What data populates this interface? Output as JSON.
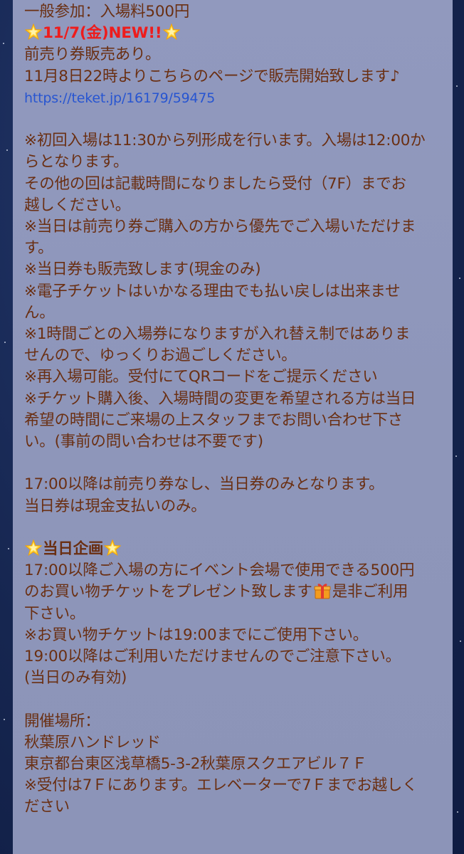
{
  "lines": [
    "一般参加：入場料500円",
    "11/7(金)NEW!!",
    "前売り券販売あり。",
    "11月8日22時よりこちらのページで販売開始致します♪",
    "https://teket.jp/16179/59475",
    "",
    "※初回入場は11:30から列形成を行います。入場は12:00か",
    "らとなります。",
    "その他の回は記載時間になりましたら受付（7F）までお",
    "越しください。",
    "※当日は前売り券ご購入の方から優先でご入場いただけま",
    "す。",
    "※当日券も販売致します(現金のみ)",
    "※電子チケットはいかなる理由でも払い戻しは出来ませ",
    "ん。",
    "※1時間ごとの入場券になりますが入れ替え制ではありま",
    "せんので、ゆっくりお過ごしください。",
    "※再入場可能。受付にてQRコードをご提示ください",
    "※チケット購入後、入場時間の変更を希望される方は当日",
    "希望の時間にご来場の上スタッフまでお問い合わせ下さ",
    "い。(事前の問い合わせは不要です)",
    "",
    "17:00以降は前売り券なし、当日券のみとなります。",
    "当日券は現金支払いのみ。",
    "",
    "当日企画",
    "17:00以降ご入場の方にイベント会場で使用できる500円",
    "のお買い物チケットをプレゼント致します",
    "是非ご利用",
    "下さい。",
    "※お買い物チケットは19:00までにご使用下さい。",
    "19:00以降はご利用いただけませんのでご注意下さい。",
    "(当日のみ有効)",
    "",
    "開催場所：",
    "秋葉原ハンドレッド",
    "東京都台東区浅草橋5-3-2秋葉原スクエアビル７Ｆ",
    "※受付は7Ｆにあります。エレベーターで7Ｆまでお越しく",
    "ださい"
  ],
  "icons": {
    "star": "glowing-star-icon",
    "gift": "gift-box-icon"
  },
  "colors": {
    "text": "#6a2f12",
    "accent_red": "#ee1c1c",
    "link": "#2755d1",
    "panel": "#8f97bb",
    "background": "#162650"
  }
}
